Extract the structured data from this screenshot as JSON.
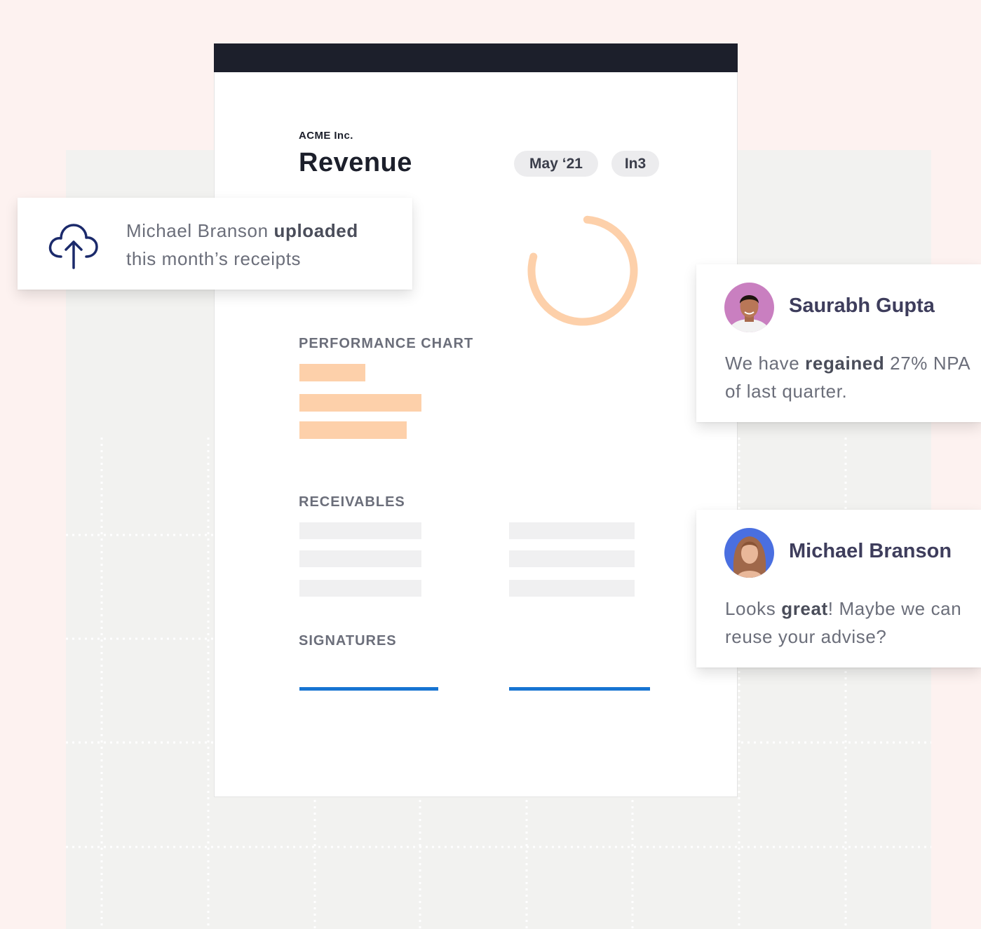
{
  "document": {
    "company": "ACME Inc.",
    "title": "Revenue",
    "date_pill": "May ‘21",
    "org_pill": "In3",
    "sections": {
      "performance": "PERFORMANCE CHART",
      "receivables": "RECEIVABLES",
      "signatures": "SIGNATURES"
    },
    "progress_ring_fraction": 0.78
  },
  "upload_notification": {
    "user": "Michael Branson",
    "action": "uploaded",
    "detail": "this month’s receipts",
    "icon": "cloud-upload-icon"
  },
  "comments": [
    {
      "name": "Saurabh Gupta",
      "text_before": "We have ",
      "text_bold": "regained",
      "text_after": " 27% NPA of last quarter."
    },
    {
      "name": "Michael Branson",
      "text_before": "Looks ",
      "text_bold": "great",
      "text_after": "! Maybe we can reuse your advise?"
    }
  ],
  "colors": {
    "accent_peach": "#fdd0aa",
    "accent_blue": "#1774d2",
    "dark": "#1c1f2b",
    "ring": "#fdd0aa"
  }
}
